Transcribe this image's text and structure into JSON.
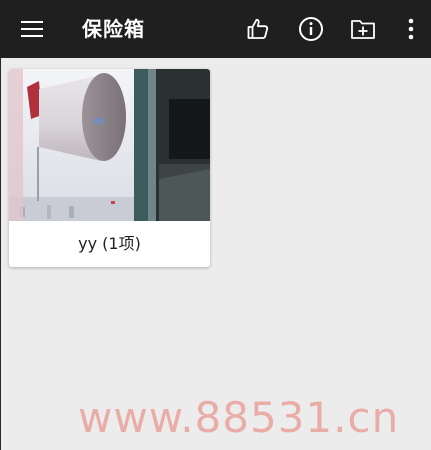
{
  "toolbar": {
    "title": "保险箱",
    "menu_icon": "hamburger-menu-icon",
    "like_icon": "thumbs-up-icon",
    "info_icon": "info-icon",
    "add_folder_icon": "add-folder-icon",
    "more_icon": "more-vertical-icon",
    "background": "#1f1f1f"
  },
  "albums": [
    {
      "label": "yy (1项)"
    }
  ],
  "watermark": "www.88531.cn",
  "colors": {
    "content_bg": "#ececec",
    "watermark": "#e8786e"
  }
}
